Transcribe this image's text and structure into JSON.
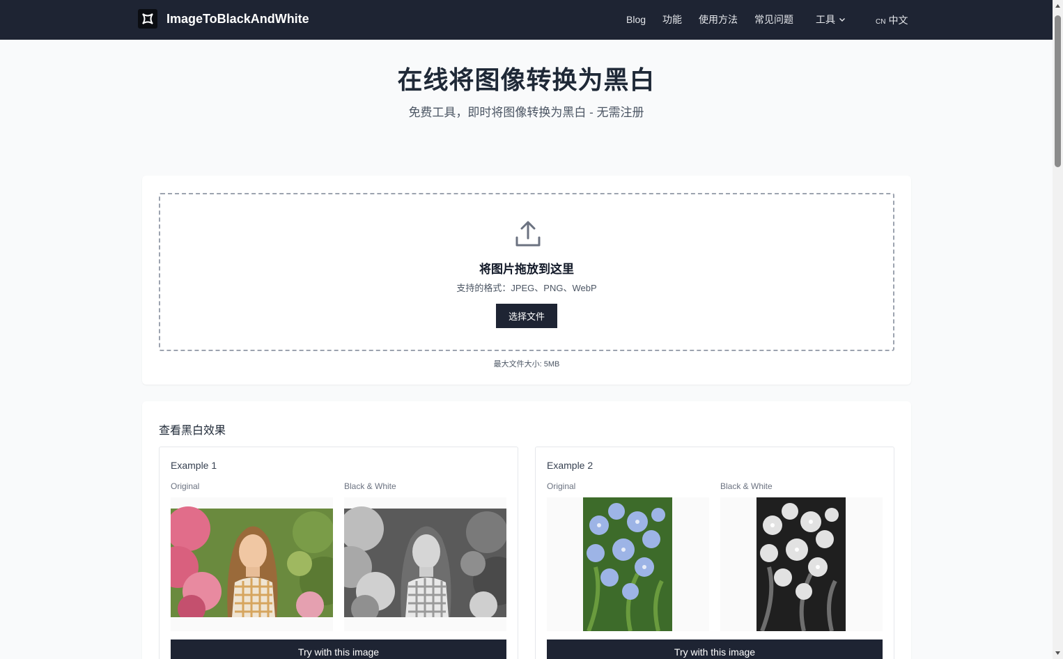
{
  "nav": {
    "brand": "ImageToBlackAndWhite",
    "links": [
      "Blog",
      "功能",
      "使用方法",
      "常见问题"
    ],
    "tools_label": "工具",
    "lang_code": "CN",
    "lang_name": "中文"
  },
  "hero": {
    "title": "在线将图像转换为黑白",
    "subtitle": "免费工具，即时将图像转换为黑白 - 无需注册"
  },
  "upload": {
    "title": "将图片拖放到这里",
    "formats": "支持的格式：JPEG、PNG、WebP",
    "button": "选择文件",
    "max_size": "最大文件大小: 5MB"
  },
  "examples": {
    "title": "查看黑白效果",
    "items": [
      {
        "title": "Example 1",
        "original_label": "Original",
        "bw_label": "Black & White",
        "button": "Try with this image"
      },
      {
        "title": "Example 2",
        "original_label": "Original",
        "bw_label": "Black & White",
        "button": "Try with this image"
      }
    ]
  },
  "colors": {
    "navbar_bg": "#1e2433",
    "button_bg": "#1e2433",
    "page_bg": "#f9fafb"
  },
  "icons": [
    "logo-icon",
    "chevron-down-icon",
    "upload-icon",
    "scroll-up-icon",
    "scroll-down-icon"
  ]
}
